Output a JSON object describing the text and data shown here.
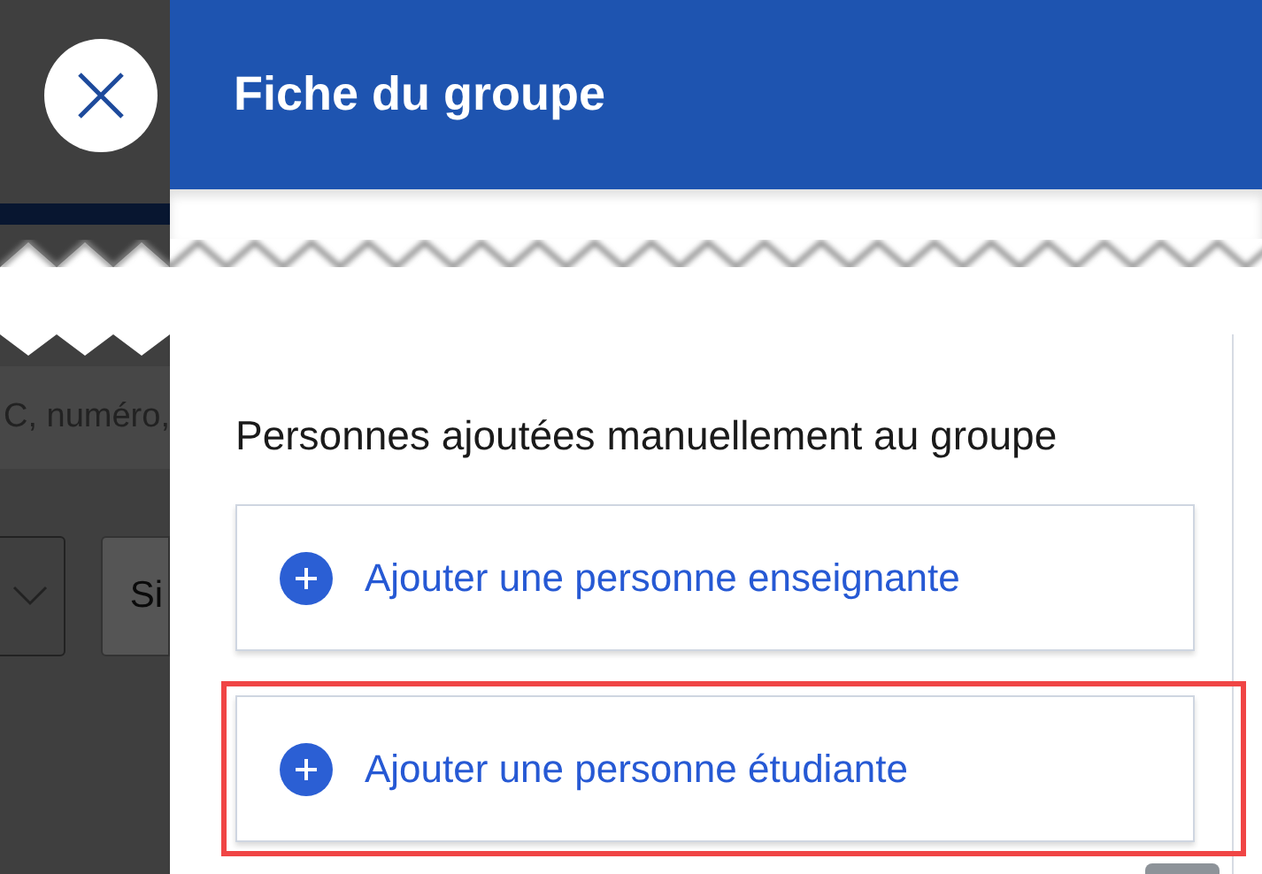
{
  "panel": {
    "title": "Fiche du groupe"
  },
  "background": {
    "search_placeholder": "C, numéro,",
    "select_text": "Si"
  },
  "section": {
    "heading": "Personnes ajoutées manuellement au groupe",
    "actions": [
      {
        "label": "Ajouter une personne enseignante",
        "highlighted": false
      },
      {
        "label": "Ajouter une personne étudiante",
        "highlighted": true
      }
    ]
  }
}
